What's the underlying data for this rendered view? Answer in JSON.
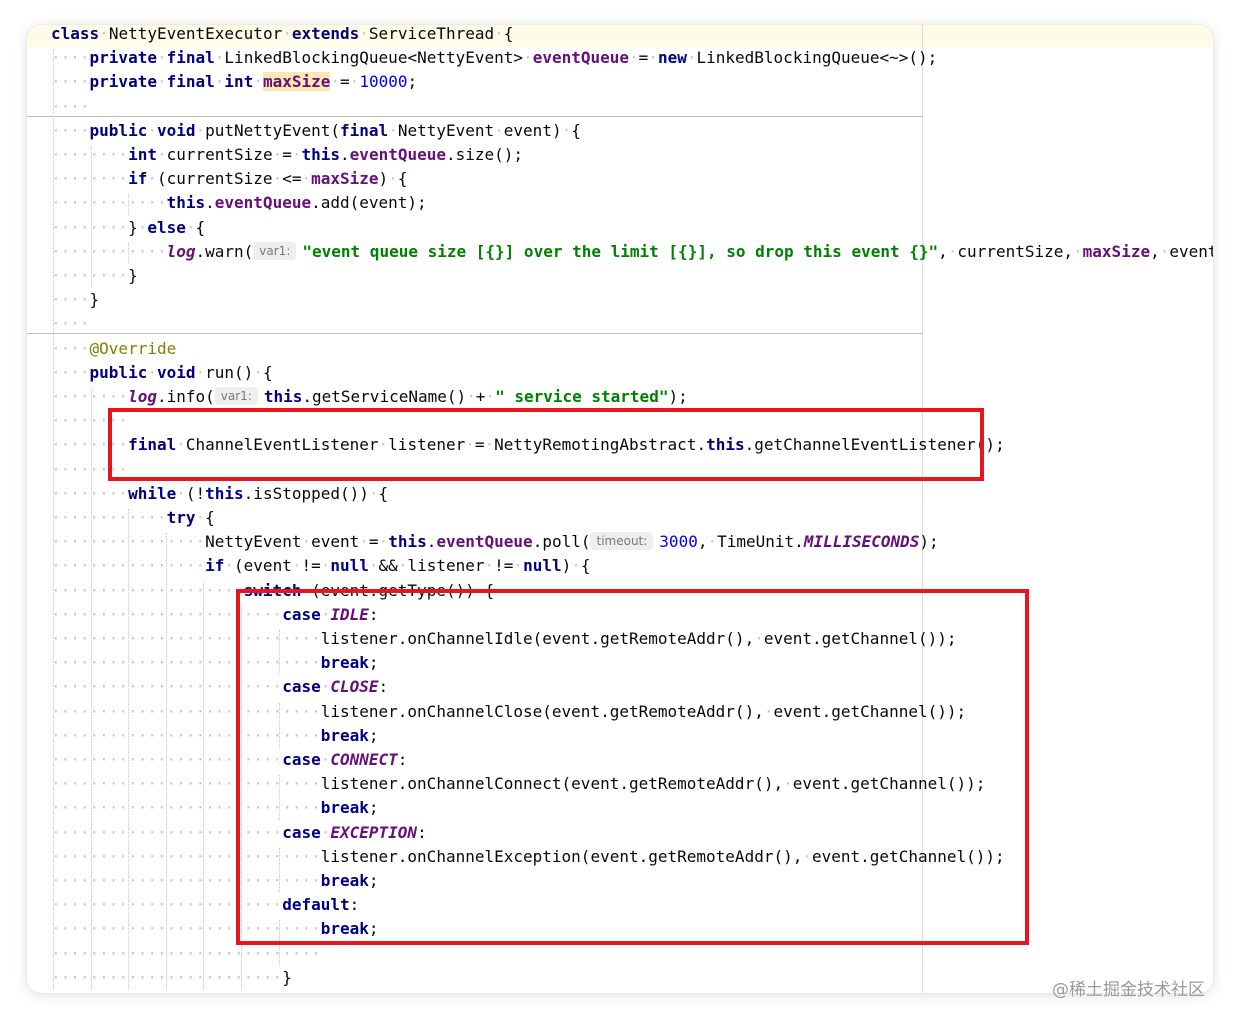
{
  "editor": {
    "lines": [
      [
        [
          "kw",
          "class"
        ],
        [
          "ws",
          " "
        ],
        [
          "ident",
          "NettyEventExecutor"
        ],
        [
          "ws",
          " "
        ],
        [
          "kw",
          "extends"
        ],
        [
          "ws",
          " "
        ],
        [
          "ident",
          "ServiceThread"
        ],
        [
          "ws",
          " "
        ],
        [
          "ident",
          "{"
        ]
      ],
      [
        [
          "kw",
          "private"
        ],
        [
          "ws",
          " "
        ],
        [
          "kw",
          "final"
        ],
        [
          "ws",
          " "
        ],
        [
          "ident",
          "LinkedBlockingQueue<NettyEvent>"
        ],
        [
          "ws",
          " "
        ],
        [
          "fld",
          "eventQueue"
        ],
        [
          "ws",
          " "
        ],
        [
          "ident",
          "="
        ],
        [
          "ws",
          " "
        ],
        [
          "kw",
          "new"
        ],
        [
          "ws",
          " "
        ],
        [
          "ident",
          "LinkedBlockingQueue<~>();"
        ]
      ],
      [
        [
          "kw",
          "private"
        ],
        [
          "ws",
          " "
        ],
        [
          "kw",
          "final"
        ],
        [
          "ws",
          " "
        ],
        [
          "kw",
          "int"
        ],
        [
          "ws",
          " "
        ],
        [
          "fld",
          "maxSize"
        ],
        [
          "ws",
          " "
        ],
        [
          "ident",
          "="
        ],
        [
          "ws",
          " "
        ],
        [
          "num",
          "10000"
        ],
        [
          "ident",
          ";"
        ]
      ],
      [],
      [
        [
          "kw",
          "public"
        ],
        [
          "ws",
          " "
        ],
        [
          "kw",
          "void"
        ],
        [
          "ws",
          " "
        ],
        [
          "ident",
          "putNettyEvent("
        ],
        [
          "kw",
          "final"
        ],
        [
          "ws",
          " "
        ],
        [
          "ident",
          "NettyEvent"
        ],
        [
          "ws",
          " "
        ],
        [
          "ident",
          "event)"
        ],
        [
          "ws",
          " "
        ],
        [
          "ident",
          "{"
        ]
      ],
      [
        [
          "kw",
          "int"
        ],
        [
          "ws",
          " "
        ],
        [
          "ident",
          "currentSize"
        ],
        [
          "ws",
          " "
        ],
        [
          "ident",
          "="
        ],
        [
          "ws",
          " "
        ],
        [
          "kw",
          "this"
        ],
        [
          "ident",
          "."
        ],
        [
          "fld",
          "eventQueue"
        ],
        [
          "ident",
          ".size();"
        ]
      ],
      [
        [
          "kw",
          "if"
        ],
        [
          "ws",
          " "
        ],
        [
          "ident",
          "(currentSize"
        ],
        [
          "ws",
          " "
        ],
        [
          "ident",
          "<="
        ],
        [
          "ws",
          " "
        ],
        [
          "fld",
          "maxSize"
        ],
        [
          "ident",
          ")"
        ],
        [
          "ws",
          " "
        ],
        [
          "ident",
          "{"
        ]
      ],
      [
        [
          "kw",
          "this"
        ],
        [
          "ident",
          "."
        ],
        [
          "fld",
          "eventQueue"
        ],
        [
          "ident",
          ".add(event);"
        ]
      ],
      [
        [
          "ident",
          "}"
        ],
        [
          "ws",
          " "
        ],
        [
          "kw",
          "else"
        ],
        [
          "ws",
          " "
        ],
        [
          "ident",
          "{"
        ]
      ],
      [
        [
          "log",
          "log"
        ],
        [
          "ident",
          ".warn("
        ],
        [
          "hint",
          "var1:"
        ],
        [
          "str",
          "\"event queue size [{}] over the limit [{}], so drop this event {}\""
        ],
        [
          "ident",
          ","
        ],
        [
          "ws",
          " "
        ],
        [
          "ident",
          "currentSize,"
        ],
        [
          "ws",
          " "
        ],
        [
          "fld",
          "maxSize"
        ],
        [
          "ident",
          ","
        ],
        [
          "ws",
          " "
        ],
        [
          "ident",
          "event.toStr"
        ]
      ],
      [
        [
          "ident",
          "}"
        ]
      ],
      [
        [
          "ident",
          "}"
        ]
      ],
      [],
      [
        [
          "ann",
          "@Override"
        ]
      ],
      [
        [
          "kw",
          "public"
        ],
        [
          "ws",
          " "
        ],
        [
          "kw",
          "void"
        ],
        [
          "ws",
          " "
        ],
        [
          "ident",
          "run()"
        ],
        [
          "ws",
          " "
        ],
        [
          "ident",
          "{"
        ]
      ],
      [
        [
          "log",
          "log"
        ],
        [
          "ident",
          ".info("
        ],
        [
          "hint",
          "var1:"
        ],
        [
          "kw",
          "this"
        ],
        [
          "ident",
          ".getServiceName()"
        ],
        [
          "ws",
          " "
        ],
        [
          "ident",
          "+"
        ],
        [
          "ws",
          " "
        ],
        [
          "str",
          "\" service started\""
        ],
        [
          "ident",
          ");"
        ]
      ],
      [],
      [
        [
          "kw",
          "final"
        ],
        [
          "ws",
          " "
        ],
        [
          "ident",
          "ChannelEventListener"
        ],
        [
          "ws",
          " "
        ],
        [
          "ident",
          "listener"
        ],
        [
          "ws",
          " "
        ],
        [
          "ident",
          "="
        ],
        [
          "ws",
          " "
        ],
        [
          "ident",
          "NettyRemotingAbstract."
        ],
        [
          "kw",
          "this"
        ],
        [
          "ident",
          ".getChannelEventListener();"
        ]
      ],
      [],
      [
        [
          "kw",
          "while"
        ],
        [
          "ws",
          " "
        ],
        [
          "ident",
          "(!"
        ],
        [
          "kw",
          "this"
        ],
        [
          "ident",
          ".isStopped())"
        ],
        [
          "ws",
          " "
        ],
        [
          "ident",
          "{"
        ]
      ],
      [
        [
          "kw",
          "try"
        ],
        [
          "ws",
          " "
        ],
        [
          "ident",
          "{"
        ]
      ],
      [
        [
          "ident",
          "NettyEvent"
        ],
        [
          "ws",
          " "
        ],
        [
          "ident",
          "event"
        ],
        [
          "ws",
          " "
        ],
        [
          "ident",
          "="
        ],
        [
          "ws",
          " "
        ],
        [
          "kw",
          "this"
        ],
        [
          "ident",
          "."
        ],
        [
          "fld",
          "eventQueue"
        ],
        [
          "ident",
          ".poll("
        ],
        [
          "hint",
          "timeout:"
        ],
        [
          "num",
          "3000"
        ],
        [
          "ident",
          ","
        ],
        [
          "ws",
          " "
        ],
        [
          "ident",
          "TimeUnit."
        ],
        [
          "sfld",
          "MILLISECONDS"
        ],
        [
          "ident",
          ");"
        ]
      ],
      [
        [
          "kw",
          "if"
        ],
        [
          "ws",
          " "
        ],
        [
          "ident",
          "(event"
        ],
        [
          "ws",
          " "
        ],
        [
          "ident",
          "!="
        ],
        [
          "ws",
          " "
        ],
        [
          "kw",
          "null"
        ],
        [
          "ws",
          " "
        ],
        [
          "ident",
          "&&"
        ],
        [
          "ws",
          " "
        ],
        [
          "ident",
          "listener"
        ],
        [
          "ws",
          " "
        ],
        [
          "ident",
          "!="
        ],
        [
          "ws",
          " "
        ],
        [
          "kw",
          "null"
        ],
        [
          "ident",
          ")"
        ],
        [
          "ws",
          " "
        ],
        [
          "ident",
          "{"
        ]
      ],
      [
        [
          "kw",
          "switch"
        ],
        [
          "ws",
          " "
        ],
        [
          "ident",
          "(event.getType())"
        ],
        [
          "ws",
          " "
        ],
        [
          "ident",
          "{"
        ]
      ],
      [
        [
          "kw",
          "case"
        ],
        [
          "ws",
          " "
        ],
        [
          "sfld",
          "IDLE"
        ],
        [
          "ident",
          ":"
        ]
      ],
      [
        [
          "ident",
          "listener.onChannelIdle(event.getRemoteAddr(),"
        ],
        [
          "ws",
          " "
        ],
        [
          "ident",
          "event.getChannel());"
        ]
      ],
      [
        [
          "kw",
          "break"
        ],
        [
          "ident",
          ";"
        ]
      ],
      [
        [
          "kw",
          "case"
        ],
        [
          "ws",
          " "
        ],
        [
          "sfld",
          "CLOSE"
        ],
        [
          "ident",
          ":"
        ]
      ],
      [
        [
          "ident",
          "listener.onChannelClose(event.getRemoteAddr(),"
        ],
        [
          "ws",
          " "
        ],
        [
          "ident",
          "event.getChannel());"
        ]
      ],
      [
        [
          "kw",
          "break"
        ],
        [
          "ident",
          ";"
        ]
      ],
      [
        [
          "kw",
          "case"
        ],
        [
          "ws",
          " "
        ],
        [
          "sfld",
          "CONNECT"
        ],
        [
          "ident",
          ":"
        ]
      ],
      [
        [
          "ident",
          "listener.onChannelConnect(event.getRemoteAddr(),"
        ],
        [
          "ws",
          " "
        ],
        [
          "ident",
          "event.getChannel());"
        ]
      ],
      [
        [
          "kw",
          "break"
        ],
        [
          "ident",
          ";"
        ]
      ],
      [
        [
          "kw",
          "case"
        ],
        [
          "ws",
          " "
        ],
        [
          "sfld",
          "EXCEPTION"
        ],
        [
          "ident",
          ":"
        ]
      ],
      [
        [
          "ident",
          "listener.onChannelException(event.getRemoteAddr(),"
        ],
        [
          "ws",
          " "
        ],
        [
          "ident",
          "event.getChannel());"
        ]
      ],
      [
        [
          "kw",
          "break"
        ],
        [
          "ident",
          ";"
        ]
      ],
      [
        [
          "kw",
          "default"
        ],
        [
          "ident",
          ":"
        ]
      ],
      [
        [
          "kw",
          "break"
        ],
        [
          "ident",
          ";"
        ]
      ],
      [],
      [
        [
          "ident",
          "}"
        ]
      ]
    ]
  },
  "watermark": "@稀土掘金技术社区",
  "colors": {
    "keyword": "#000080",
    "field": "#660e7a",
    "number": "#0000ff",
    "string": "#008000",
    "annotation": "#808000",
    "annotation_box": "#e8141e"
  }
}
